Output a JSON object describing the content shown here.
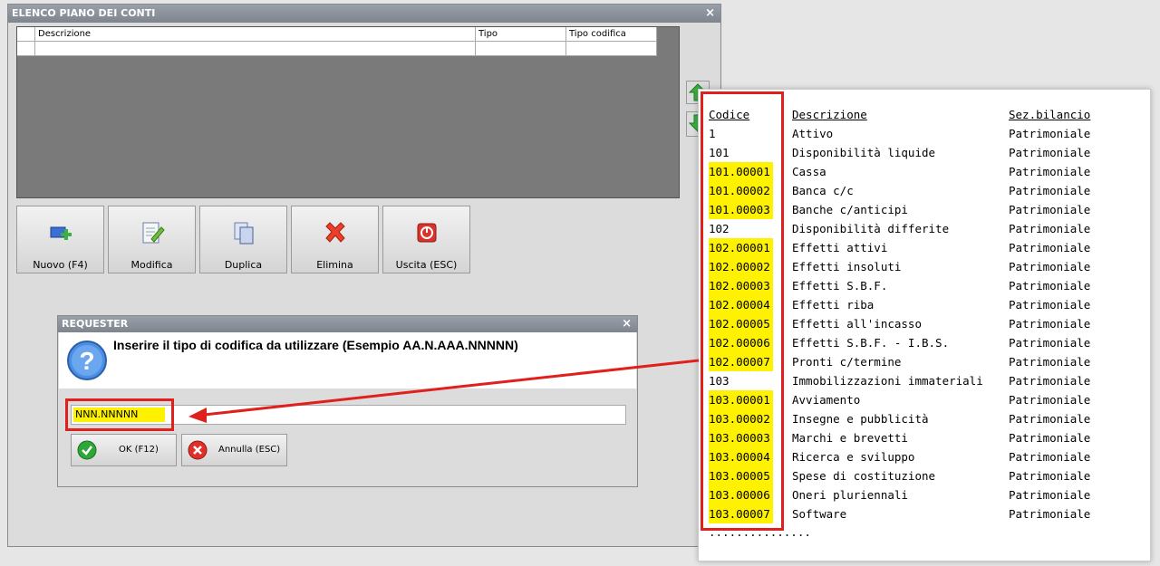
{
  "window": {
    "title": "ELENCO PIANO DEI CONTI",
    "close": "×"
  },
  "grid": {
    "columns": [
      "Descrizione",
      "Tipo",
      "Tipo codifica"
    ]
  },
  "toolbar": [
    {
      "label": "Nuovo (F4)",
      "icon": "new-record-icon"
    },
    {
      "label": "Modifica",
      "icon": "edit-icon"
    },
    {
      "label": "Duplica",
      "icon": "duplicate-icon"
    },
    {
      "label": "Elimina",
      "icon": "delete-icon"
    },
    {
      "label": "Uscita (ESC)",
      "icon": "exit-icon"
    }
  ],
  "requester": {
    "title": "REQUESTER",
    "close": "×",
    "message": "Inserire il tipo di codifica da utilizzare (Esempio AA.N.AAA.NNNNN)",
    "input_value": "NNN.NNNNN",
    "ok_label": "OK (F12)",
    "cancel_label": "Annulla (ESC)"
  },
  "panel": {
    "headers": {
      "code": "Codice",
      "desc": "Descrizione",
      "sez": "Sez.bilancio"
    },
    "rows": [
      {
        "code": "1",
        "desc": "Attivo",
        "sez": "Patrimoniale"
      },
      {
        "code": "101",
        "desc": "Disponibilità liquide",
        "sez": "Patrimoniale"
      },
      {
        "code": "101.00001",
        "desc": "Cassa",
        "sez": "Patrimoniale"
      },
      {
        "code": "101.00002",
        "desc": "Banca c/c",
        "sez": "Patrimoniale"
      },
      {
        "code": "101.00003",
        "desc": "Banche c/anticipi",
        "sez": "Patrimoniale"
      },
      {
        "code": "102",
        "desc": "Disponibilità differite",
        "sez": "Patrimoniale"
      },
      {
        "code": "102.00001",
        "desc": "Effetti attivi",
        "sez": "Patrimoniale"
      },
      {
        "code": "102.00002",
        "desc": "Effetti insoluti",
        "sez": "Patrimoniale"
      },
      {
        "code": "102.00003",
        "desc": "Effetti S.B.F.",
        "sez": "Patrimoniale"
      },
      {
        "code": "102.00004",
        "desc": "Effetti riba",
        "sez": "Patrimoniale"
      },
      {
        "code": "102.00005",
        "desc": "Effetti all'incasso",
        "sez": "Patrimoniale"
      },
      {
        "code": "102.00006",
        "desc": "Effetti S.B.F. - I.B.S.",
        "sez": "Patrimoniale"
      },
      {
        "code": "102.00007",
        "desc": "Pronti c/termine",
        "sez": "Patrimoniale"
      },
      {
        "code": "103",
        "desc": "Immobilizzazioni immateriali",
        "sez": "Patrimoniale"
      },
      {
        "code": "103.00001",
        "desc": "Avviamento",
        "sez": "Patrimoniale"
      },
      {
        "code": "103.00002",
        "desc": "Insegne e pubblicità",
        "sez": "Patrimoniale"
      },
      {
        "code": "103.00003",
        "desc": "Marchi e brevetti",
        "sez": "Patrimoniale"
      },
      {
        "code": "103.00004",
        "desc": "Ricerca e sviluppo",
        "sez": "Patrimoniale"
      },
      {
        "code": "103.00005",
        "desc": "Spese di costituzione",
        "sez": "Patrimoniale"
      },
      {
        "code": "103.00006",
        "desc": "Oneri pluriennali",
        "sez": "Patrimoniale"
      },
      {
        "code": "103.00007",
        "desc": "Software",
        "sez": "Patrimoniale"
      }
    ],
    "ellipsis": "..............."
  },
  "colors": {
    "highlight": "#fff200",
    "callout": "#e0201c"
  }
}
